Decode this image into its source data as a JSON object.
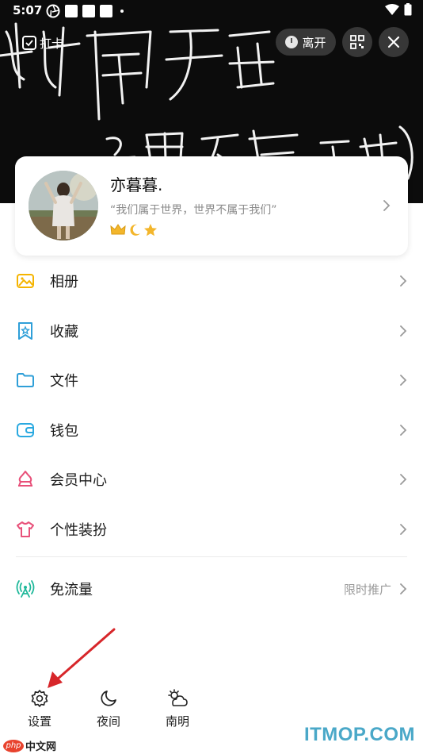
{
  "status_bar": {
    "time": "5:07"
  },
  "header": {
    "punch_label": "打卡",
    "leave_label": "离开"
  },
  "profile": {
    "name": "亦暮暮.",
    "signature": "“我们属于世界，世界不属于我们”",
    "badges": [
      "crown-icon",
      "moon-icon",
      "star-icon"
    ]
  },
  "menu": {
    "items": [
      {
        "label": "相册",
        "icon": "album-icon",
        "color": "#f5b400"
      },
      {
        "label": "收藏",
        "icon": "favorites-icon",
        "color": "#2f9fd8"
      },
      {
        "label": "文件",
        "icon": "folder-icon",
        "color": "#2f9fd8"
      },
      {
        "label": "钱包",
        "icon": "wallet-icon",
        "color": "#2aa9e0"
      },
      {
        "label": "会员中心",
        "icon": "vip-icon",
        "color": "#e8517a"
      },
      {
        "label": "个性装扮",
        "icon": "tshirt-icon",
        "color": "#e8517a"
      }
    ],
    "free_traffic": {
      "label": "免流量",
      "tag": "限时推广",
      "icon": "signal-icon",
      "color": "#1fb89a"
    }
  },
  "bottom_bar": {
    "settings_label": "设置",
    "night_label": "夜间",
    "weather_label": "南明"
  },
  "watermarks": {
    "left_badge": "php",
    "left_text": "中文网",
    "right_text": "ITMOP.COM"
  }
}
